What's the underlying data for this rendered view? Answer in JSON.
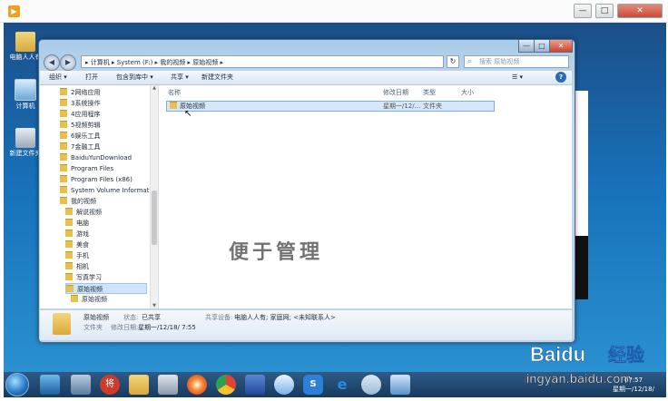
{
  "player": {
    "icon": "play-icon"
  },
  "player_controls": {
    "min": "—",
    "max": "□",
    "close": "✕"
  },
  "desktop_icons": [
    {
      "label": "电脑人人有",
      "icon": "folder-icon"
    },
    {
      "label": "计算机",
      "icon": "computer-icon"
    },
    {
      "label": "新建文件夹",
      "icon": "folder-icon"
    }
  ],
  "window": {
    "controls": {
      "min": "—",
      "max": "□",
      "close": "✕"
    }
  },
  "address_bar": {
    "path": "▸ 计算机 ▸ System (F:) ▸ 我的视频 ▸ 原始视频 ▸",
    "back": "◀",
    "forward": "▶",
    "refresh": "↻"
  },
  "search": {
    "placeholder": "搜索 原始视频"
  },
  "toolbar": {
    "organize": "组织 ▾",
    "open": "打开",
    "include": "包含到库中 ▾",
    "share": "共享 ▾",
    "new_folder": "新建文件夹",
    "view": "☰ ▾",
    "help": "?"
  },
  "sidebar": {
    "items": [
      "2网络应用",
      "3系统操作",
      "4应用程序",
      "5视频剪辑",
      "6娱乐工具",
      "7金融工具",
      "BaiduYunDownload",
      "Program Files",
      "Program Files (x86)",
      "System Volume Informatio",
      "我的视频",
      "解说视频",
      "电脑",
      "游戏",
      "美食",
      "手机",
      "相机",
      "写真学习",
      "原始视频",
      "原始视频"
    ],
    "selected_index": 18
  },
  "columns": {
    "name": "名称",
    "date": "修改日期",
    "type": "类型",
    "size": "大小"
  },
  "files": [
    {
      "name": "原始视频",
      "date": "星期一/12/...",
      "type": "文件夹",
      "size": ""
    }
  ],
  "watermark": "便于管理",
  "details": {
    "name": "原始视频",
    "state_label": "状态:",
    "state_value": "已共享",
    "type": "文件夹",
    "modified_label": "修改日期:",
    "modified_value": "星期一/12/18/ 7:55",
    "shared_label": "共享设备:",
    "shared_value": "电脑人人有; 家庭网; <未知联系人>"
  },
  "taskbar": {
    "icons": [
      "desktop-icon",
      "network-icon",
      "app-jiang-icon",
      "folder-icon",
      "tools-icon",
      "windows-media-icon",
      "chrome-icon",
      "word-icon",
      "cloud-icon",
      "sogou-icon",
      "ie-icon",
      "paint-icon",
      "monitor-icon"
    ],
    "jiang_label": "将",
    "s_label": "S",
    "e_label": "e"
  },
  "clock": {
    "time": "07:57",
    "date": "星期一/12/18/"
  },
  "baidu_watermark": {
    "brand": "Baidu",
    "label": "经验",
    "url": "jingyan.baidu.com"
  }
}
